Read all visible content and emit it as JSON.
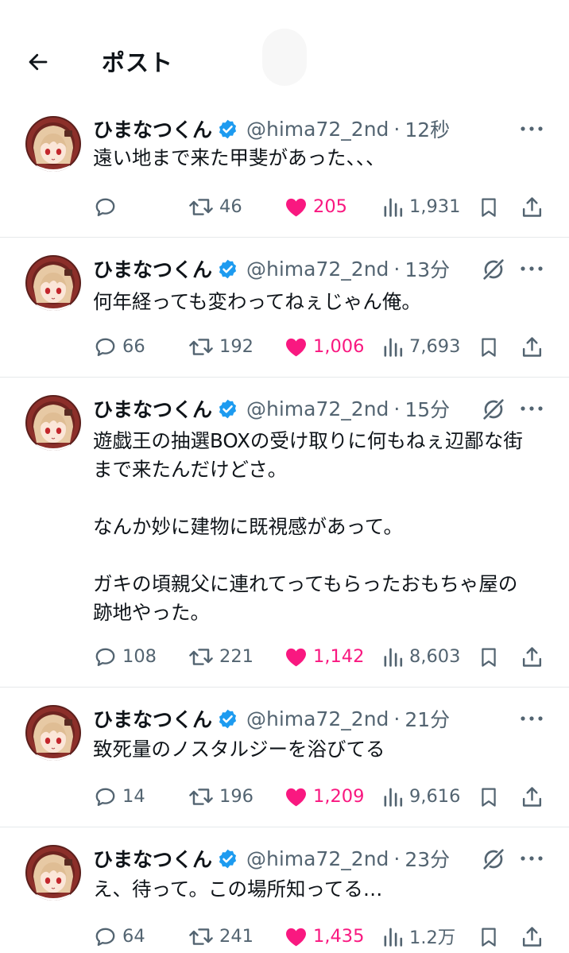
{
  "header": {
    "title": "ポスト"
  },
  "author": {
    "name": "ひまなつくん",
    "handle": "@hima72_2nd"
  },
  "posts": [
    {
      "time": "12秒",
      "text": "遠い地まで来た甲斐があった、、、",
      "replies": "",
      "reposts": "46",
      "likes": "205",
      "views": "1,931",
      "grok": false
    },
    {
      "time": "13分",
      "text": "何年経っても変わってねぇじゃん俺。",
      "replies": "66",
      "reposts": "192",
      "likes": "1,006",
      "views": "7,693",
      "grok": true
    },
    {
      "time": "15分",
      "text": "遊戯王の抽選BOXの受け取りに何もねぇ辺鄙な街\nまで来たんだけどさ。\n\nなんか妙に建物に既視感があって。\n\nガキの頃親父に連れてってもらったおもちゃ屋の\n跡地やった。",
      "replies": "108",
      "reposts": "221",
      "likes": "1,142",
      "views": "8,603",
      "grok": true
    },
    {
      "time": "21分",
      "text": "致死量のノスタルジーを浴びてる",
      "replies": "14",
      "reposts": "196",
      "likes": "1,209",
      "views": "9,616",
      "grok": false
    },
    {
      "time": "23分",
      "text": "え、待って。この場所知ってる…",
      "replies": "64",
      "reposts": "241",
      "likes": "1,435",
      "views": "1.2万",
      "grok": true
    }
  ],
  "colors": {
    "like": "#f91880",
    "verified": "#1d9bf0",
    "muted": "#536471",
    "text": "#0f1419",
    "divider": "#e6e9eb"
  },
  "icons": {
    "back": "arrow-left-icon",
    "verified": "verified-badge-icon",
    "grok": "grok-icon",
    "more": "more-icon",
    "reply": "reply-icon",
    "repost": "repost-icon",
    "like": "heart-icon",
    "views": "views-icon",
    "bookmark": "bookmark-icon",
    "share": "share-icon"
  }
}
